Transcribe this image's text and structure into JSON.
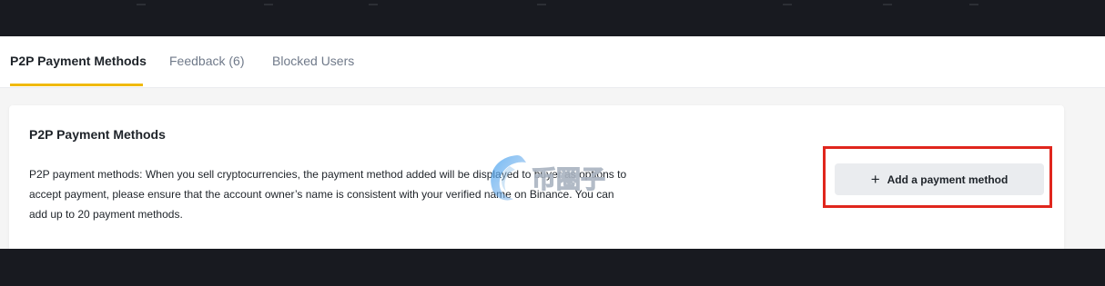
{
  "tabs": [
    {
      "label": "P2P Payment Methods",
      "active": true
    },
    {
      "label": "Feedback (6)",
      "active": false
    },
    {
      "label": "Blocked Users",
      "active": false
    }
  ],
  "card": {
    "title": "P2P Payment Methods",
    "description": "P2P payment methods: When you sell cryptocurrencies, the payment method added will be displayed to buyer as options to accept payment, please ensure that the account owner’s name is consistent with your verified name on Binance. You can add up to 20 payment methods.",
    "add_button_label": "Add a payment method",
    "add_button_icon": "plus-icon"
  },
  "watermark": {
    "text": "币圈子"
  },
  "colors": {
    "accent": "#f0b90b",
    "highlight": "#e0261d",
    "dark_bg": "#181a20",
    "text_primary": "#1e2329",
    "text_secondary": "#707a8a",
    "button_bg": "#eaecef"
  }
}
